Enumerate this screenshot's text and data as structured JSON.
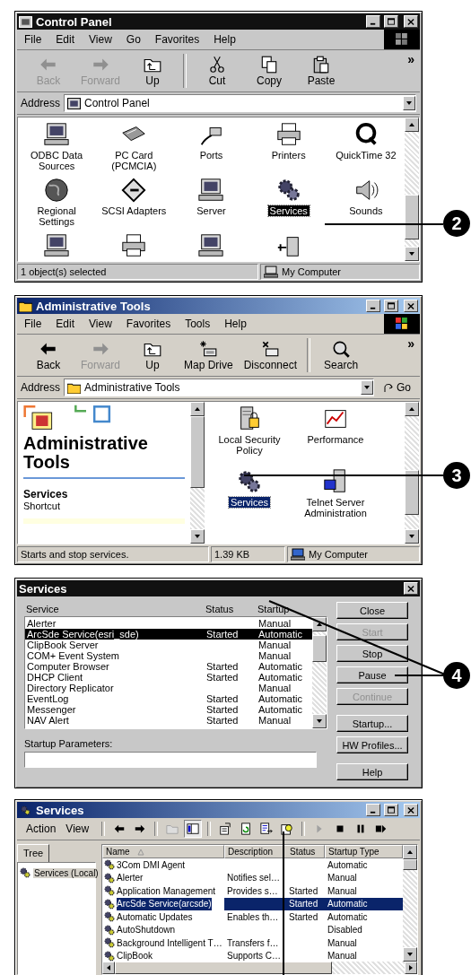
{
  "control_panel": {
    "title": "Control Panel",
    "menu": [
      "File",
      "Edit",
      "View",
      "Go",
      "Favorites",
      "Help"
    ],
    "toolbar": [
      {
        "label": "Back",
        "disabled": true
      },
      {
        "label": "Forward",
        "disabled": true
      },
      {
        "label": "Up",
        "disabled": false
      },
      {
        "label": "Cut",
        "disabled": false
      },
      {
        "label": "Copy",
        "disabled": false
      },
      {
        "label": "Paste",
        "disabled": false
      }
    ],
    "more": "»",
    "address_label": "Address",
    "address": "Control Panel",
    "items": [
      {
        "label": "ODBC Data Sources",
        "selected": false
      },
      {
        "label": "PC Card (PCMCIA)",
        "selected": false
      },
      {
        "label": "Ports",
        "selected": false
      },
      {
        "label": "Printers",
        "selected": false
      },
      {
        "label": "QuickTime 32",
        "selected": false
      },
      {
        "label": "Regional Settings",
        "selected": false
      },
      {
        "label": "SCSI Adapters",
        "selected": false
      },
      {
        "label": "Server",
        "selected": false
      },
      {
        "label": "Services",
        "selected": true
      },
      {
        "label": "Sounds",
        "selected": false
      }
    ],
    "status": [
      "1 object(s) selected",
      "My Computer"
    ],
    "callout": "2"
  },
  "admin_tools": {
    "title": "Administrative Tools",
    "menu": [
      "File",
      "Edit",
      "View",
      "Favorites",
      "Tools",
      "Help"
    ],
    "toolbar": [
      {
        "label": "Back",
        "disabled": false
      },
      {
        "label": "Forward",
        "disabled": true
      },
      {
        "label": "Up",
        "disabled": false
      },
      {
        "label": "Map Drive",
        "disabled": false
      },
      {
        "label": "Disconnect",
        "disabled": false
      },
      {
        "label": "Search",
        "disabled": false
      }
    ],
    "more": "»",
    "address_label": "Address",
    "address": "Administrative Tools",
    "go": "Go",
    "info": {
      "heading": "Administrative Tools",
      "name": "Services",
      "type": "Shortcut"
    },
    "items": [
      {
        "label": "Local Security Policy",
        "selected": false
      },
      {
        "label": "Performance",
        "selected": false
      },
      {
        "label": "Services",
        "selected": true
      },
      {
        "label": "Telnet Server Administration",
        "selected": false
      }
    ],
    "status": [
      "Starts and stop services.",
      "1.39 KB",
      "My Computer"
    ],
    "callout": "3"
  },
  "services_dialog": {
    "title": "Services",
    "columns": [
      "Service",
      "Status",
      "Startup"
    ],
    "rows": [
      {
        "service": "Alerter",
        "startup": "Manual",
        "selected": false
      },
      {
        "service": "ArcSde Service(esri_sde)",
        "status": "Started",
        "startup": "Automatic",
        "selected": true
      },
      {
        "service": "ClipBook Server",
        "startup": "Manual",
        "selected": false
      },
      {
        "service": "COM+ Event System",
        "startup": "Manual",
        "selected": false
      },
      {
        "service": "Computer Browser",
        "status": "Started",
        "startup": "Automatic",
        "selected": false
      },
      {
        "service": "DHCP Client",
        "status": "Started",
        "startup": "Automatic",
        "selected": false
      },
      {
        "service": "Directory Replicator",
        "startup": "Manual",
        "selected": false
      },
      {
        "service": "EventLog",
        "status": "Started",
        "startup": "Automatic",
        "selected": false
      },
      {
        "service": "Messenger",
        "status": "Started",
        "startup": "Automatic",
        "selected": false
      },
      {
        "service": "NAV Alert",
        "status": "Started",
        "startup": "Manual",
        "selected": false
      }
    ],
    "buttons": [
      {
        "label": "Close",
        "disabled": false
      },
      {
        "label": "Start",
        "disabled": true
      },
      {
        "label": "Stop",
        "disabled": false
      },
      {
        "label": "Pause",
        "disabled": false
      },
      {
        "label": "Continue",
        "disabled": true
      },
      {
        "label": "Startup...",
        "disabled": false
      },
      {
        "label": "HW Profiles...",
        "disabled": false
      },
      {
        "label": "Help",
        "disabled": false
      }
    ],
    "parameters_label": "Startup Parameters:",
    "callout": "4"
  },
  "services_console": {
    "title": "Services",
    "menu": [
      "Action",
      "View"
    ],
    "toolbar": [
      {
        "disabled": false,
        "pressed": false
      },
      {
        "disabled": false,
        "pressed": false
      },
      {
        "disabled": true,
        "pressed": false
      },
      {
        "disabled": false,
        "pressed": true
      },
      {
        "disabled": false,
        "pressed": false
      },
      {
        "disabled": false,
        "pressed": false
      },
      {
        "disabled": false,
        "pressed": false
      },
      {
        "disabled": false,
        "pressed": false
      },
      {
        "disabled": true,
        "pressed": false
      },
      {
        "disabled": false,
        "pressed": false
      },
      {
        "disabled": false,
        "pressed": false
      },
      {
        "disabled": false,
        "pressed": false
      }
    ],
    "tree_tab": "Tree",
    "tree_items": [
      {
        "label": "Services (Local)",
        "selected": true
      }
    ],
    "columns": [
      "Name",
      "Description",
      "Status",
      "Startup Type"
    ],
    "rows": [
      {
        "name": "3Com DMI Agent",
        "startup": "Automatic",
        "selected": false
      },
      {
        "name": "Alerter",
        "description": "Notifies sel…",
        "startup": "Manual",
        "selected": false
      },
      {
        "name": "Application Management",
        "description": "Provides s…",
        "status": "Started",
        "startup": "Manual",
        "selected": false
      },
      {
        "name": "ArcSde Service(arcsde)",
        "status": "Started",
        "startup": "Automatic",
        "selected": true
      },
      {
        "name": "Automatic Updates",
        "description": "Enables th…",
        "status": "Started",
        "startup": "Automatic",
        "selected": false
      },
      {
        "name": "AutoShutdown",
        "startup": "Disabled",
        "selected": false
      },
      {
        "name": "Background Intelligent T…",
        "description": "Transfers f…",
        "startup": "Manual",
        "selected": false
      },
      {
        "name": "ClipBook",
        "description": "Supports C…",
        "startup": "Manual",
        "selected": false
      }
    ]
  }
}
